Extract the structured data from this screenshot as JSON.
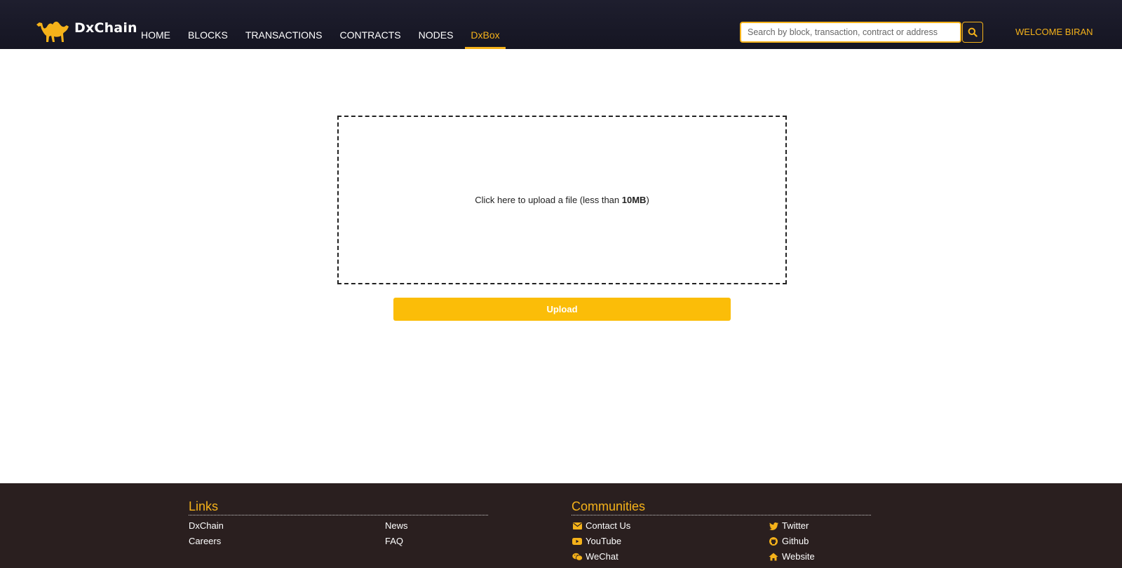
{
  "brand": {
    "name": "DxChain",
    "accent_color": "#f5b21a"
  },
  "nav": {
    "items": [
      {
        "label": "HOME"
      },
      {
        "label": "BLOCKS"
      },
      {
        "label": "TRANSACTIONS"
      },
      {
        "label": "CONTRACTS"
      },
      {
        "label": "NODES"
      },
      {
        "label": "DxBox",
        "active": true
      }
    ]
  },
  "search": {
    "placeholder": "Search by block, transaction, contract or address",
    "icon": "search-icon"
  },
  "user": {
    "welcome": "WELCOME BIRAN"
  },
  "upload": {
    "prompt_prefix": "Click here to upload a file (less than ",
    "prompt_limit": "10MB",
    "prompt_suffix": ")",
    "button_label": "Upload",
    "button_color": "#fbbd08"
  },
  "footer": {
    "links": {
      "heading": "Links",
      "items": [
        "DxChain",
        "Careers",
        "News",
        "FAQ"
      ]
    },
    "communities": {
      "heading": "Communities",
      "items": [
        {
          "label": "Contact Us",
          "icon": "envelope-icon"
        },
        {
          "label": "YouTube",
          "icon": "youtube-icon"
        },
        {
          "label": "WeChat",
          "icon": "wechat-icon"
        },
        {
          "label": "Twitter",
          "icon": "twitter-icon"
        },
        {
          "label": "Github",
          "icon": "github-icon"
        },
        {
          "label": "Website",
          "icon": "home-icon"
        }
      ]
    }
  }
}
